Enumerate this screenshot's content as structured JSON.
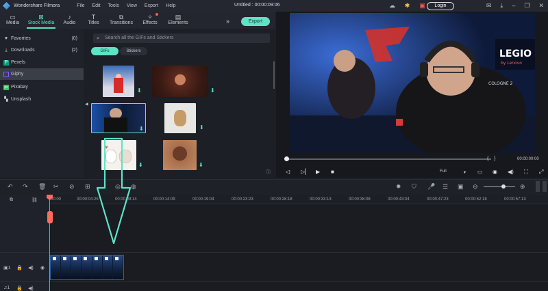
{
  "app": {
    "name": "Wondershare Filmora",
    "doc_title": "Untitled : 00:00:09:06",
    "login_label": "Login",
    "menu": [
      "File",
      "Edit",
      "Tools",
      "View",
      "Export",
      "Help"
    ]
  },
  "tabs": [
    {
      "label": "Media",
      "icon": "folder-icon"
    },
    {
      "label": "Stock Media",
      "icon": "stock-media-icon"
    },
    {
      "label": "Audio",
      "icon": "music-note-icon"
    },
    {
      "label": "Titles",
      "icon": "text-t-icon"
    },
    {
      "label": "Transitions",
      "icon": "transitions-icon"
    },
    {
      "label": "Effects",
      "icon": "effects-icon"
    },
    {
      "label": "Elements",
      "icon": "elements-icon"
    }
  ],
  "export_label": "Export",
  "sidebar": {
    "items": [
      {
        "label": "Favorites",
        "count": "(0)",
        "icon": "heart-icon"
      },
      {
        "label": "Downloads",
        "count": "(2)",
        "icon": "download-icon"
      },
      {
        "label": "Pexels",
        "count": "",
        "icon": "pexels-icon"
      },
      {
        "label": "Giphy",
        "count": "",
        "icon": "giphy-icon"
      },
      {
        "label": "Pixabay",
        "count": "",
        "icon": "pixabay-icon"
      },
      {
        "label": "Unsplash",
        "count": "",
        "icon": "unsplash-icon"
      }
    ]
  },
  "browser": {
    "search_placeholder": "Search all the GIFs and Stickers",
    "seg_gifs": "GIFs",
    "seg_stickers": "Stickers"
  },
  "preview": {
    "timecode": "00:00:00:00",
    "quality": "Full"
  },
  "ruler": {
    "ticks": [
      "00:00",
      "00:00:04:25",
      "00:00:09:14",
      "00:00:14:09",
      "00:00:19:04",
      "00:00:23:23",
      "00:00:28:18",
      "00:00:33:13",
      "00:00:38:08",
      "00:00:43:04",
      "00:00:47:23",
      "00:00:52:18",
      "00:00:57:13"
    ]
  },
  "colors": {
    "accent": "#5fe3c6",
    "playhead": "#ff6b5e",
    "background": "#1c1f26"
  }
}
